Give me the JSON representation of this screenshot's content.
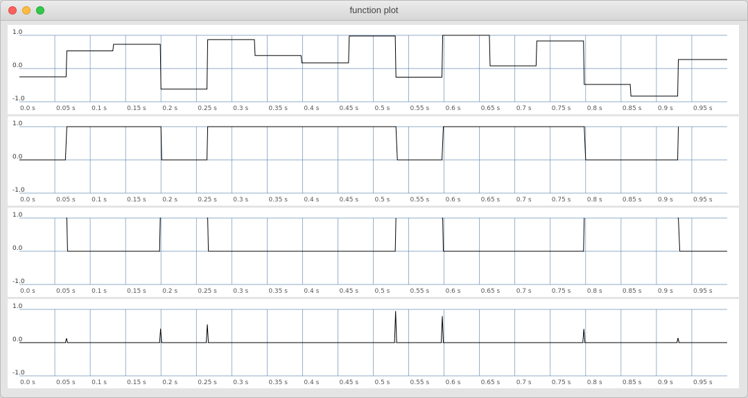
{
  "window": {
    "title": "function plot",
    "controls": {
      "close_color": "#fc605c",
      "minimize_color": "#fdbc40",
      "zoom_color": "#34c84a"
    }
  },
  "colors": {
    "grid": "#6a8fb5",
    "trace": "#000000",
    "panel_bg": "#ffffff"
  },
  "chart_data": [
    {
      "type": "line",
      "xlim": [
        0,
        1
      ],
      "ylim": [
        -1,
        1
      ],
      "x_ticks": [
        0,
        0.05,
        0.1,
        0.15,
        0.2,
        0.25,
        0.3,
        0.35,
        0.4,
        0.45,
        0.5,
        0.55,
        0.6,
        0.65,
        0.7,
        0.75,
        0.8,
        0.85,
        0.9,
        0.95
      ],
      "x_tick_labels": [
        "0.0 s",
        "0.05 s",
        "0.1 s",
        "0.15 s",
        "0.2 s",
        "0.25 s",
        "0.3 s",
        "0.35 s",
        "0.4 s",
        "0.45 s",
        "0.5 s",
        "0.55 s",
        "0.6 s",
        "0.65 s",
        "0.7 s",
        "0.75 s",
        "0.8 s",
        "0.85 s",
        "0.9 s",
        "0.95 s"
      ],
      "y_ticks": [
        -1,
        0,
        1
      ],
      "y_tick_labels": [
        "-1.0",
        "0.0",
        "1.0"
      ],
      "grid": true,
      "series": [
        {
          "x": [
            0,
            0.066,
            0.067,
            0.132,
            0.133,
            0.199,
            0.2,
            0.265,
            0.266,
            0.332,
            0.333,
            0.398,
            0.399,
            0.465,
            0.466,
            0.531,
            0.532,
            0.597,
            0.598,
            0.664,
            0.665,
            0.73,
            0.731,
            0.797,
            0.798,
            0.863,
            0.864,
            0.93,
            0.931,
            1.0
          ],
          "y": [
            -0.25,
            -0.25,
            0.53,
            0.53,
            0.73,
            0.73,
            -0.62,
            -0.62,
            0.87,
            0.87,
            0.39,
            0.39,
            0.17,
            0.17,
            0.98,
            0.98,
            -0.26,
            -0.26,
            1.0,
            1.0,
            0.08,
            0.08,
            0.83,
            0.83,
            -0.48,
            -0.48,
            -0.83,
            -0.83,
            0.27,
            0.27
          ]
        }
      ]
    },
    {
      "type": "line",
      "xlim": [
        0,
        1
      ],
      "ylim": [
        -1,
        1
      ],
      "x_ticks": [
        0,
        0.05,
        0.1,
        0.15,
        0.2,
        0.25,
        0.3,
        0.35,
        0.4,
        0.45,
        0.5,
        0.55,
        0.6,
        0.65,
        0.7,
        0.75,
        0.8,
        0.85,
        0.9,
        0.95
      ],
      "x_tick_labels": [
        "0.0 s",
        "0.05 s",
        "0.1 s",
        "0.15 s",
        "0.2 s",
        "0.25 s",
        "0.3 s",
        "0.35 s",
        "0.4 s",
        "0.45 s",
        "0.5 s",
        "0.55 s",
        "0.6 s",
        "0.65 s",
        "0.7 s",
        "0.75 s",
        "0.8 s",
        "0.85 s",
        "0.9 s",
        "0.95 s"
      ],
      "y_ticks": [
        -1,
        0,
        1
      ],
      "y_tick_labels": [
        "-1.0",
        "0.0",
        "1.0"
      ],
      "grid": true,
      "series": [
        {
          "x": [
            0,
            0.065,
            0.067,
            0.199,
            0.2,
            0.201,
            0.265,
            0.266,
            0.531,
            0.532,
            0.534,
            0.597,
            0.599,
            0.797,
            0.798,
            0.8,
            0.93,
            0.931
          ],
          "y": [
            0,
            0,
            1,
            1,
            1,
            0,
            0,
            1,
            1,
            1,
            0,
            0,
            1,
            1,
            1,
            0,
            0,
            1
          ]
        }
      ]
    },
    {
      "type": "line",
      "xlim": [
        0,
        1
      ],
      "ylim": [
        -1,
        1
      ],
      "x_ticks": [
        0,
        0.05,
        0.1,
        0.15,
        0.2,
        0.25,
        0.3,
        0.35,
        0.4,
        0.45,
        0.5,
        0.55,
        0.6,
        0.65,
        0.7,
        0.75,
        0.8,
        0.85,
        0.9,
        0.95
      ],
      "x_tick_labels": [
        "0.0 s",
        "0.05 s",
        "0.1 s",
        "0.15 s",
        "0.2 s",
        "0.25 s",
        "0.3 s",
        "0.35 s",
        "0.4 s",
        "0.45 s",
        "0.5 s",
        "0.55 s",
        "0.6 s",
        "0.65 s",
        "0.7 s",
        "0.75 s",
        "0.8 s",
        "0.85 s",
        "0.9 s",
        "0.95 s"
      ],
      "y_ticks": [
        -1,
        0,
        1
      ],
      "y_tick_labels": [
        "-1.0",
        "0.0",
        "1.0"
      ],
      "grid": true,
      "series": [
        {
          "x": [
            0.066,
            0.067,
            0.068
          ],
          "y": [
            1,
            1,
            0
          ]
        },
        {
          "x": [
            0.068,
            0.198,
            0.199,
            0.2
          ],
          "y": [
            0,
            0,
            1,
            1
          ]
        },
        {
          "x": [
            0.265,
            0.266,
            0.267
          ],
          "y": [
            1,
            1,
            0
          ]
        },
        {
          "x": [
            0.267,
            0.531,
            0.532
          ],
          "y": [
            0,
            0,
            1
          ]
        },
        {
          "x": [
            0.597,
            0.598,
            0.599
          ],
          "y": [
            1,
            1,
            0
          ]
        },
        {
          "x": [
            0.599,
            0.797,
            0.798
          ],
          "y": [
            0,
            0,
            1
          ]
        },
        {
          "x": [
            0.93,
            0.931,
            0.933
          ],
          "y": [
            1,
            1,
            0
          ]
        },
        {
          "x": [
            0.933,
            1.0
          ],
          "y": [
            0,
            0
          ]
        }
      ]
    },
    {
      "type": "line",
      "xlim": [
        0,
        1
      ],
      "ylim": [
        -1,
        1
      ],
      "x_ticks": [
        0,
        0.05,
        0.1,
        0.15,
        0.2,
        0.25,
        0.3,
        0.35,
        0.4,
        0.45,
        0.5,
        0.55,
        0.6,
        0.65,
        0.7,
        0.75,
        0.8,
        0.85,
        0.9,
        0.95
      ],
      "x_tick_labels": [
        "0.0 s",
        "0.05 s",
        "0.1 s",
        "0.15 s",
        "0.2 s",
        "0.25 s",
        "0.3 s",
        "0.35 s",
        "0.4 s",
        "0.45 s",
        "0.5 s",
        "0.55 s",
        "0.6 s",
        "0.65 s",
        "0.7 s",
        "0.75 s",
        "0.8 s",
        "0.85 s",
        "0.9 s",
        "0.95 s"
      ],
      "y_ticks": [
        -1,
        0,
        1
      ],
      "y_tick_labels": [
        "-1.0",
        "0.0",
        "1.0"
      ],
      "grid": true,
      "series": [
        {
          "x": [
            0,
            0.065,
            0.0665,
            0.068,
            0.198,
            0.1995,
            0.201,
            0.264,
            0.2655,
            0.267,
            0.53,
            0.5315,
            0.533,
            0.596,
            0.5975,
            0.599,
            0.796,
            0.7975,
            0.799,
            0.929,
            0.9305,
            0.932,
            1.0
          ],
          "y": [
            0,
            0,
            0.13,
            0,
            0,
            0.42,
            0,
            0,
            0.55,
            0,
            0,
            0.95,
            0,
            0,
            0.8,
            0,
            0,
            0.41,
            0,
            0,
            0.14,
            0,
            0
          ]
        }
      ]
    }
  ]
}
